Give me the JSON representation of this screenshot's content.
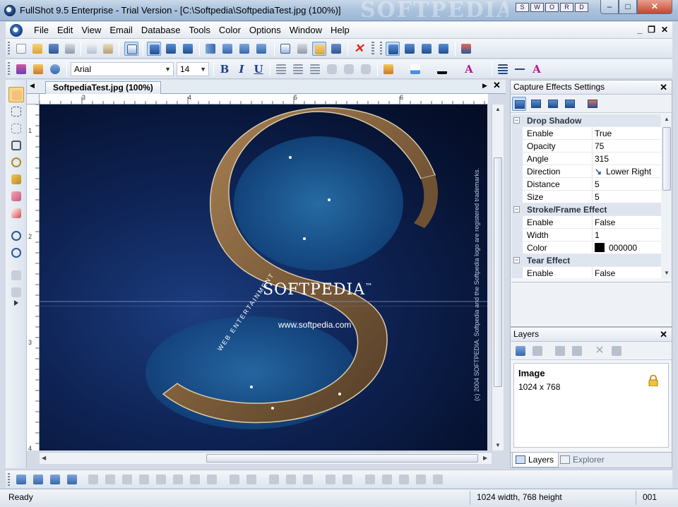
{
  "window": {
    "title": "FullShot 9.5 Enterprise - Trial Version - [C:\\Softpedia\\SoftpediaTest.jpg (100%)]",
    "watermark": "SOFTPEDIA",
    "badges": [
      "S",
      "W",
      "O",
      "R",
      "D"
    ],
    "controls": {
      "minimize": "–",
      "maximize": "□",
      "close": "✕"
    }
  },
  "menu": {
    "items": [
      "File",
      "Edit",
      "View",
      "Email",
      "Database",
      "Tools",
      "Color",
      "Options",
      "Window",
      "Help"
    ],
    "mdi": {
      "minimize": "_",
      "restore": "❐",
      "close": "✕"
    }
  },
  "format_toolbar": {
    "font": "Arial",
    "size": "14",
    "bold": "B",
    "italic": "I",
    "underline": "U",
    "text_color_label": "A"
  },
  "document": {
    "tab_label": "SoftpediaTest.jpg (100%)",
    "ruler_top": [
      "3",
      "4",
      "5",
      "6"
    ],
    "ruler_left": [
      "1",
      "2",
      "3",
      "4"
    ],
    "image": {
      "brand": "SOFTPEDIA",
      "tm": "™",
      "url": "www.softpedia.com",
      "arc_text": "WEB ENTERTAINMENT",
      "side_note": "(c) 2004 SOFTPEDIA. Softpedia and the Softpedia logo are registered trademarks."
    }
  },
  "capture_effects": {
    "title": "Capture Effects Settings",
    "rows": [
      {
        "type": "category",
        "label": "Drop Shadow"
      },
      {
        "key": "Enable",
        "value": "True"
      },
      {
        "key": "Opacity",
        "value": "75"
      },
      {
        "key": "Angle",
        "value": "315"
      },
      {
        "key": "Direction",
        "value": "Lower Right"
      },
      {
        "key": "Distance",
        "value": "5"
      },
      {
        "key": "Size",
        "value": "5"
      },
      {
        "type": "category",
        "label": "Stroke/Frame Effect"
      },
      {
        "key": "Enable",
        "value": "False"
      },
      {
        "key": "Width",
        "value": "1"
      },
      {
        "key": "Color",
        "value": "000000"
      },
      {
        "type": "category",
        "label": "Tear Effect"
      },
      {
        "key": "Enable",
        "value": "False"
      }
    ]
  },
  "layers": {
    "title": "Layers",
    "layer_name": "Image",
    "layer_size": "1024 x 768",
    "tabs": [
      "Layers",
      "Explorer"
    ]
  },
  "status": {
    "left": "Ready",
    "dimensions": "1024 width, 768 height",
    "page": "001"
  },
  "colors": {
    "accent": "#2a5ea8",
    "selected_bg": "#c6dcf5",
    "canvas_sea": "#0f2456",
    "land": "#8c6a45"
  }
}
